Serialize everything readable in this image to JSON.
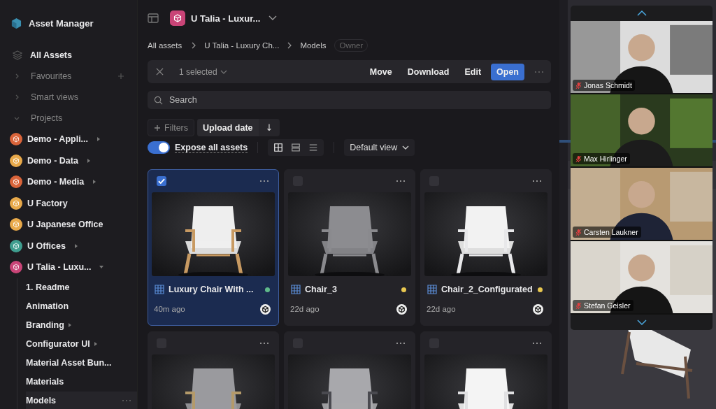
{
  "sidebar": {
    "title": "Asset Manager",
    "all_assets": "All Assets",
    "sections": [
      {
        "label": "Favourites",
        "expanded": false,
        "addable": true
      },
      {
        "label": "Smart views",
        "expanded": false
      },
      {
        "label": "Projects",
        "expanded": true
      }
    ],
    "projects": [
      {
        "label": "Demo - Appli...",
        "color": "#d9643a",
        "has_arrow": true,
        "expanded": false
      },
      {
        "label": "Demo - Data",
        "color": "#e8a94a",
        "has_arrow": true,
        "expanded": false
      },
      {
        "label": "Demo - Media",
        "color": "#d9643a",
        "has_arrow": true,
        "expanded": false
      },
      {
        "label": "U Factory",
        "color": "#e8a94a",
        "has_arrow": false
      },
      {
        "label": "U Japanese Office",
        "color": "#e8a94a",
        "has_arrow": false
      },
      {
        "label": "U Offices",
        "color": "#3f9e8f",
        "has_arrow": true,
        "expanded": false
      },
      {
        "label": "U Talia - Luxu...",
        "color": "#c94477",
        "has_arrow": true,
        "expanded": true,
        "children": [
          {
            "label": "1. Readme",
            "has_arrow": false,
            "selected": false
          },
          {
            "label": "Animation",
            "has_arrow": false,
            "selected": false
          },
          {
            "label": "Branding",
            "has_arrow": true,
            "selected": false
          },
          {
            "label": "Configurator UI",
            "has_arrow": true,
            "selected": false
          },
          {
            "label": "Material Asset Bun...",
            "has_arrow": false,
            "selected": false
          },
          {
            "label": "Materials",
            "has_arrow": false,
            "selected": false
          },
          {
            "label": "Models",
            "has_arrow": false,
            "selected": true
          }
        ]
      }
    ]
  },
  "header": {
    "project": "U Talia - Luxur...",
    "breadcrumbs": [
      "All assets",
      "U Talia - Luxury Ch...",
      "Models"
    ],
    "role": "Owner"
  },
  "selection_bar": {
    "count": "1 selected",
    "actions": [
      {
        "label": "Move",
        "primary": false
      },
      {
        "label": "Download",
        "primary": false
      },
      {
        "label": "Edit",
        "primary": false
      },
      {
        "label": "Open",
        "primary": true
      }
    ]
  },
  "search": {
    "placeholder": "Search"
  },
  "filters": {
    "label": "Filters",
    "sort": "Upload date",
    "direction": "↓"
  },
  "expose": {
    "label": "Expose all assets",
    "on": true
  },
  "view_modes": [
    {
      "kind": "grid",
      "selected": true
    },
    {
      "kind": "rows",
      "selected": false
    },
    {
      "kind": "list",
      "selected": false
    }
  ],
  "view": "Default view",
  "assets": [
    {
      "name": "Luxury Chair With ...",
      "time": "40m ago",
      "selected": true,
      "color": "#5fb98a"
    },
    {
      "name": "Chair_3",
      "time": "22d ago",
      "selected": false,
      "color": "#e8c750"
    },
    {
      "name": "Chair_2_Configurated",
      "time": "22d ago",
      "selected": false,
      "color": "#e8c750"
    },
    {
      "selected": false
    },
    {
      "selected": false
    },
    {
      "selected": false
    }
  ],
  "participants": [
    {
      "name": "Jonas Schmidt",
      "muted": true
    },
    {
      "name": "Max Hirlinger",
      "muted": true
    },
    {
      "name": "Carsten Laukner",
      "muted": true
    },
    {
      "name": "Stefan Geisler",
      "muted": true
    }
  ]
}
